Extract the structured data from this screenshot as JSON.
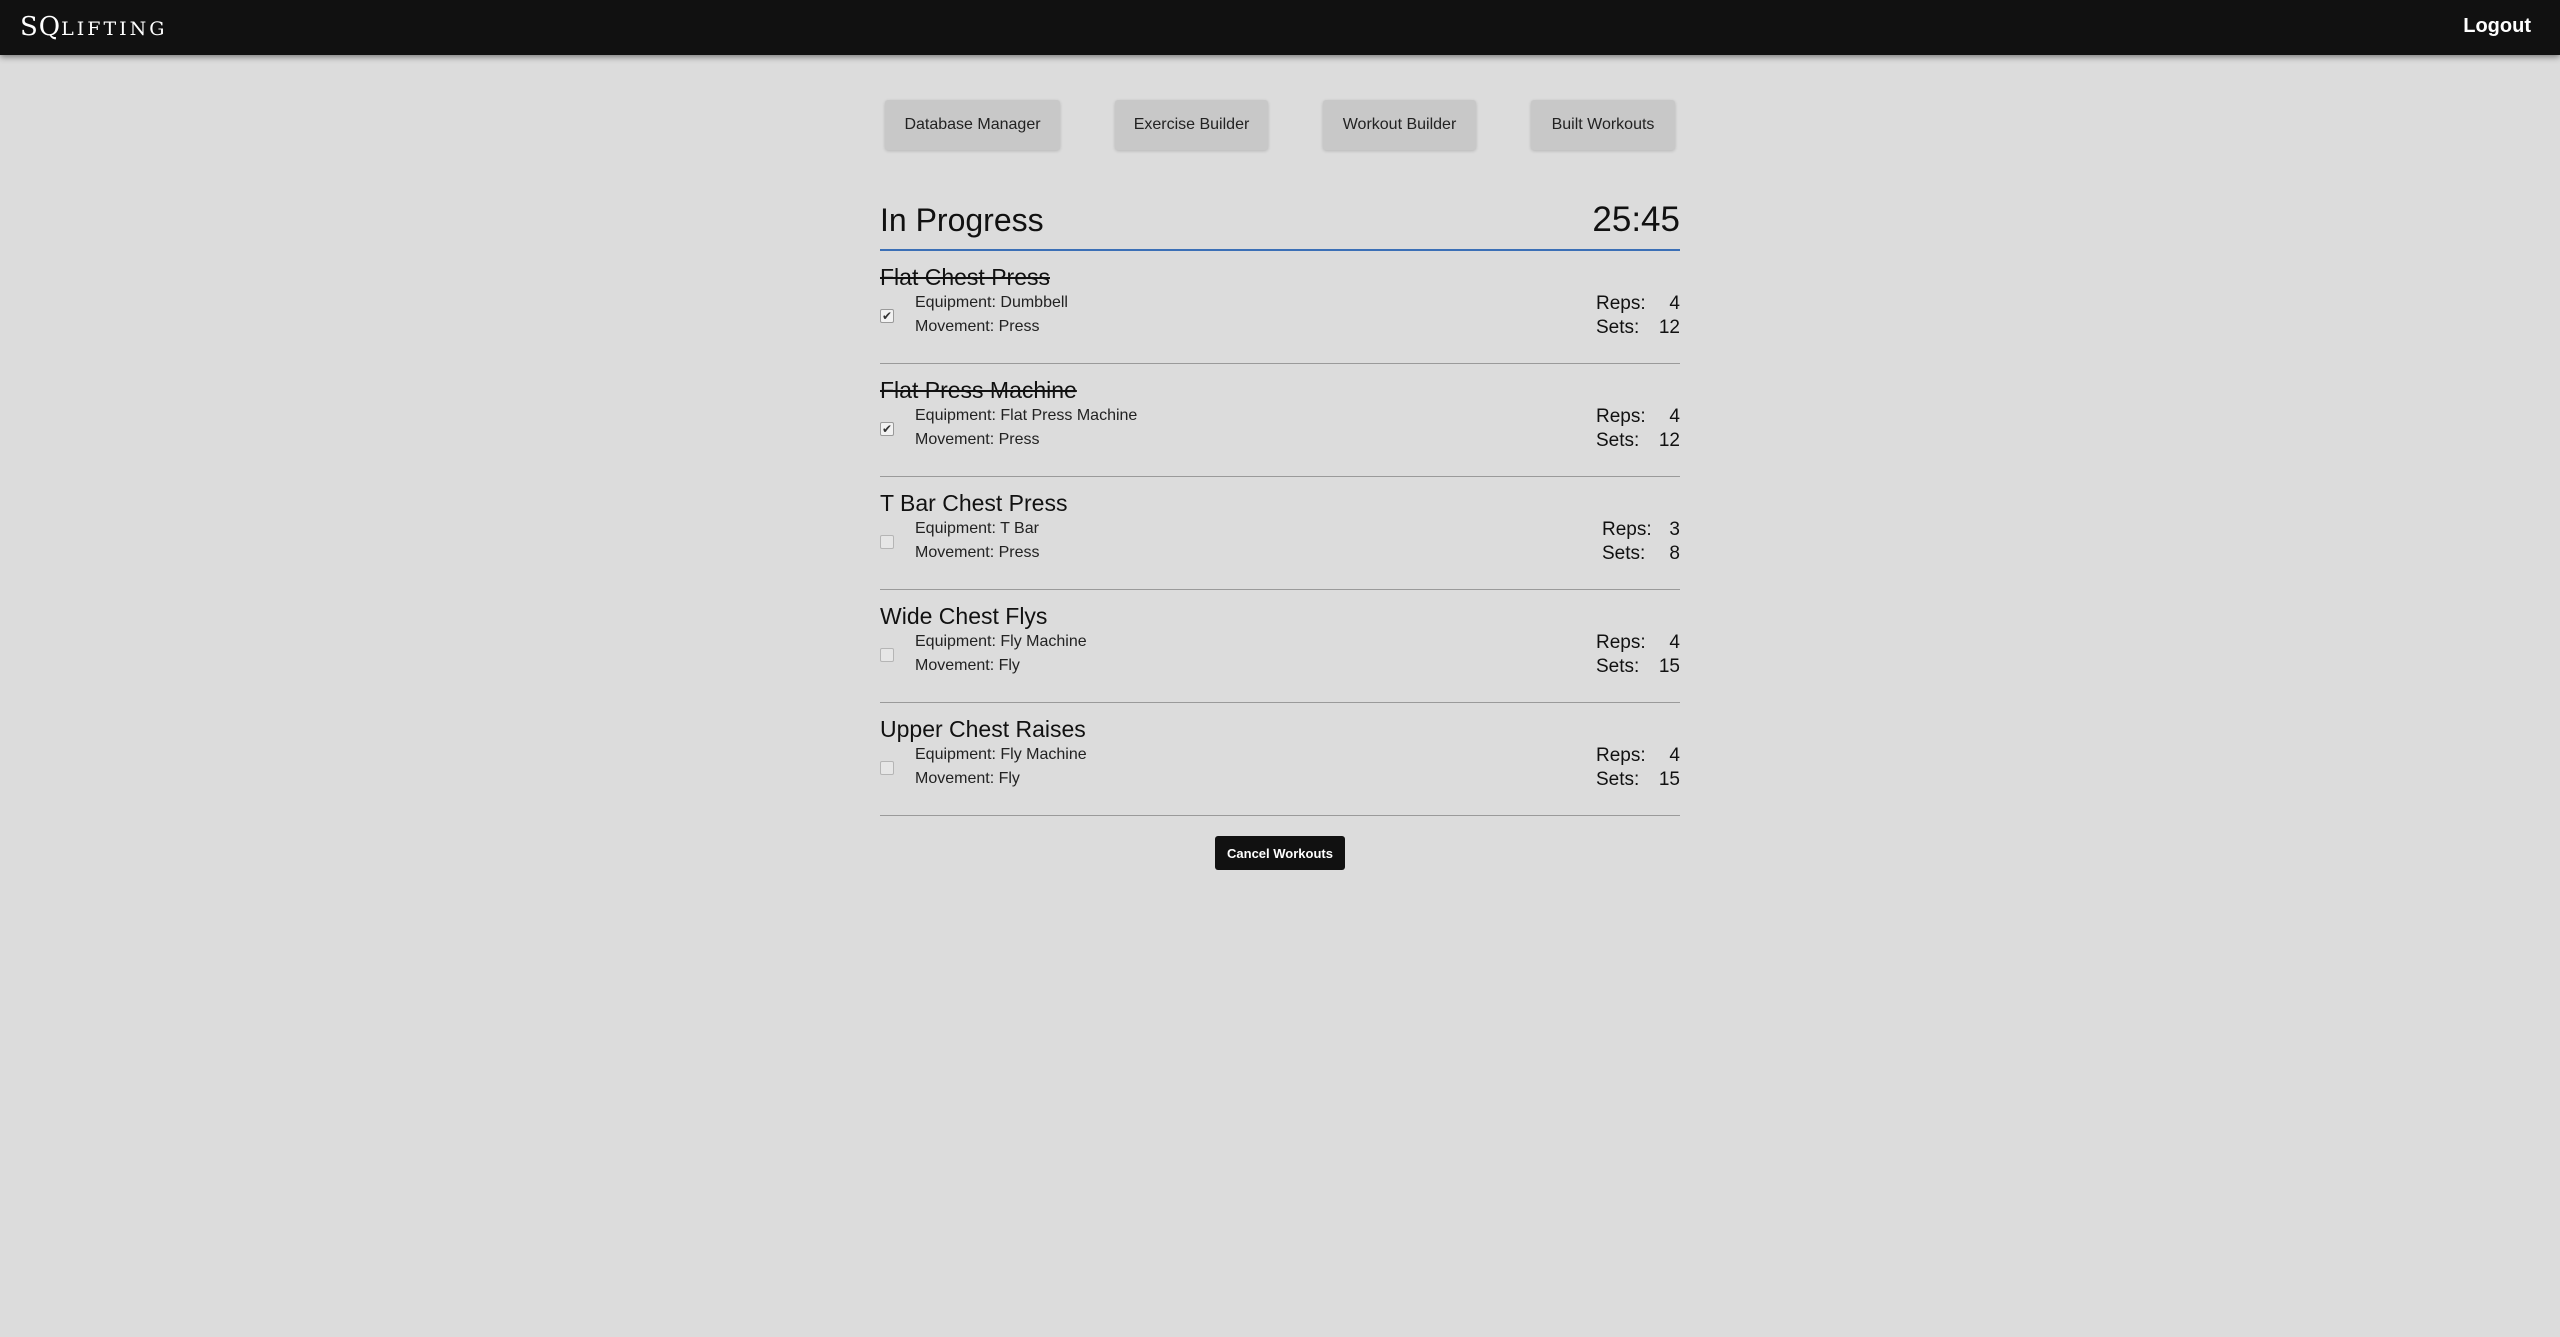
{
  "app": {
    "brand_main": "SQ",
    "brand_rest": "LIFTING",
    "logout_label": "Logout"
  },
  "nav": {
    "buttons": [
      "Database Manager",
      "Exercise Builder",
      "Workout Builder",
      "Built Workouts"
    ]
  },
  "workout": {
    "title": "In Progress",
    "timer": "25:45",
    "reps_label": "Reps:",
    "sets_label": "Sets:",
    "exercises": [
      {
        "name": "Flat Chest Press",
        "completed": true,
        "equipment": "Equipment: Dumbbell",
        "movement": "Movement: Press",
        "reps": "4",
        "sets": "12"
      },
      {
        "name": "Flat Press Machine",
        "completed": true,
        "equipment": "Equipment: Flat Press Machine",
        "movement": "Movement: Press",
        "reps": "4",
        "sets": "12"
      },
      {
        "name": "T Bar Chest Press",
        "completed": false,
        "equipment": "Equipment: T Bar",
        "movement": "Movement: Press",
        "reps": "3",
        "sets": "8"
      },
      {
        "name": "Wide Chest Flys",
        "completed": false,
        "equipment": "Equipment: Fly Machine",
        "movement": "Movement: Fly",
        "reps": "4",
        "sets": "15"
      },
      {
        "name": "Upper Chest Raises",
        "completed": false,
        "equipment": "Equipment: Fly Machine",
        "movement": "Movement: Fly",
        "reps": "4",
        "sets": "15"
      }
    ],
    "cancel_label": "Cancel Workouts"
  },
  "colors": {
    "topbar": "#111111",
    "background": "#dcdcdc",
    "header_underline": "#3b6fb6",
    "nav_button": "#c8c8c8"
  }
}
